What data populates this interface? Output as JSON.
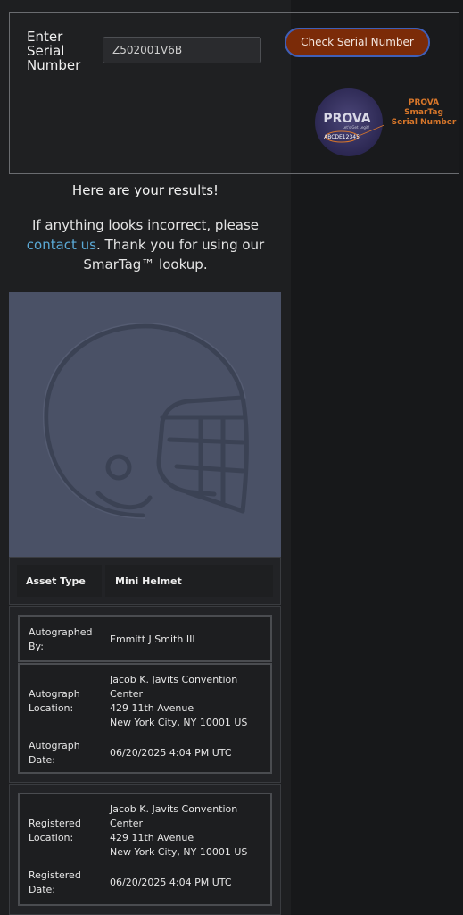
{
  "lookup": {
    "label_lines": [
      "Enter",
      "Serial",
      "Number"
    ],
    "serial_value": "Z502001V6B",
    "check_button": "Check Serial Number",
    "badge_brand": "PROVA",
    "badge_tagline": "Let's Get Legit!",
    "badge_serial": "ABCDE12345",
    "badge_caption_line1": "PROVA SmarTag",
    "badge_caption_line2": "Serial Number"
  },
  "results": {
    "title": "Here are your results!",
    "msg_prefix": "If anything looks incorrect, please ",
    "msg_link": "contact us",
    "msg_suffix": ". Thank you for using our SmarTag™ lookup."
  },
  "asset": {
    "label": "Asset Type",
    "value": "Mini Helmet"
  },
  "autograph": {
    "by_label_1": "Autographed",
    "by_label_2": "By:",
    "by_value": "Emmitt J Smith III",
    "location_label_1": "Autograph",
    "location_label_2": "Location:",
    "location_lines": [
      "Jacob K. Javits Convention",
      "Center",
      "429 11th Avenue",
      "New York City, NY 10001 US"
    ],
    "date_label_1": "Autograph",
    "date_label_2": "Date:",
    "date_value": "06/20/2025 4:04 PM UTC"
  },
  "registered": {
    "location_label_1": "Registered",
    "location_label_2": "Location:",
    "location_lines": [
      "Jacob K. Javits Convention",
      "Center",
      "429 11th Avenue",
      "New York City, NY 10001 US"
    ],
    "date_label_1": "Registered",
    "date_label_2": "Date:",
    "date_value": "06/20/2025 4:04 PM UTC"
  },
  "colors": {
    "button_bg": "#7b2b08",
    "button_border": "#3f5fb8",
    "link": "#5aa9d6",
    "badge_caption": "#d9772a",
    "image_bg": "#4a5166"
  }
}
